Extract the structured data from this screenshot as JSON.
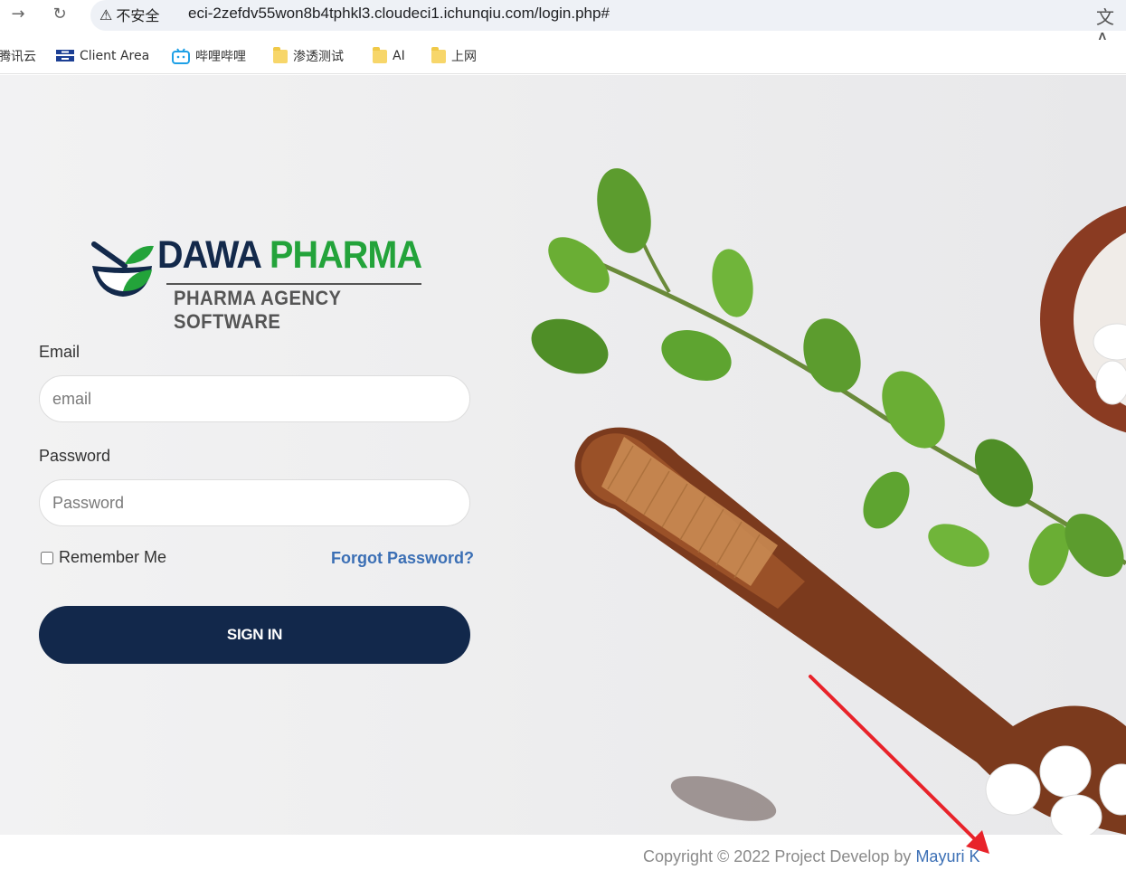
{
  "browser": {
    "security_label": "不安全",
    "url": "eci-2zefdv55won8b4tphkl3.cloudeci1.ichunqiu.com/login.php#",
    "bookmarks": [
      {
        "label": "腾讯云"
      },
      {
        "label": "Client Area"
      },
      {
        "label": "哔哩哔哩"
      },
      {
        "label": "渗透测试"
      },
      {
        "label": "AI"
      },
      {
        "label": "上网"
      }
    ]
  },
  "logo": {
    "word1": "DAWA",
    "word2": "PHARMA",
    "tagline": "PHARMA AGENCY SOFTWARE"
  },
  "form": {
    "email_label": "Email",
    "email_placeholder": "email",
    "password_label": "Password",
    "password_placeholder": "Password",
    "remember_label": "Remember Me",
    "forgot_label": "Forgot Password?",
    "signin_label": "SIGN IN"
  },
  "footer": {
    "copyright_prefix": "Copyright © 2022 Project Develop by",
    "author": "Mayuri K"
  },
  "colors": {
    "brand_navy": "#12284b",
    "brand_green": "#23a33a",
    "link_blue": "#3b6fb5",
    "annotation_red": "#e8232a"
  }
}
